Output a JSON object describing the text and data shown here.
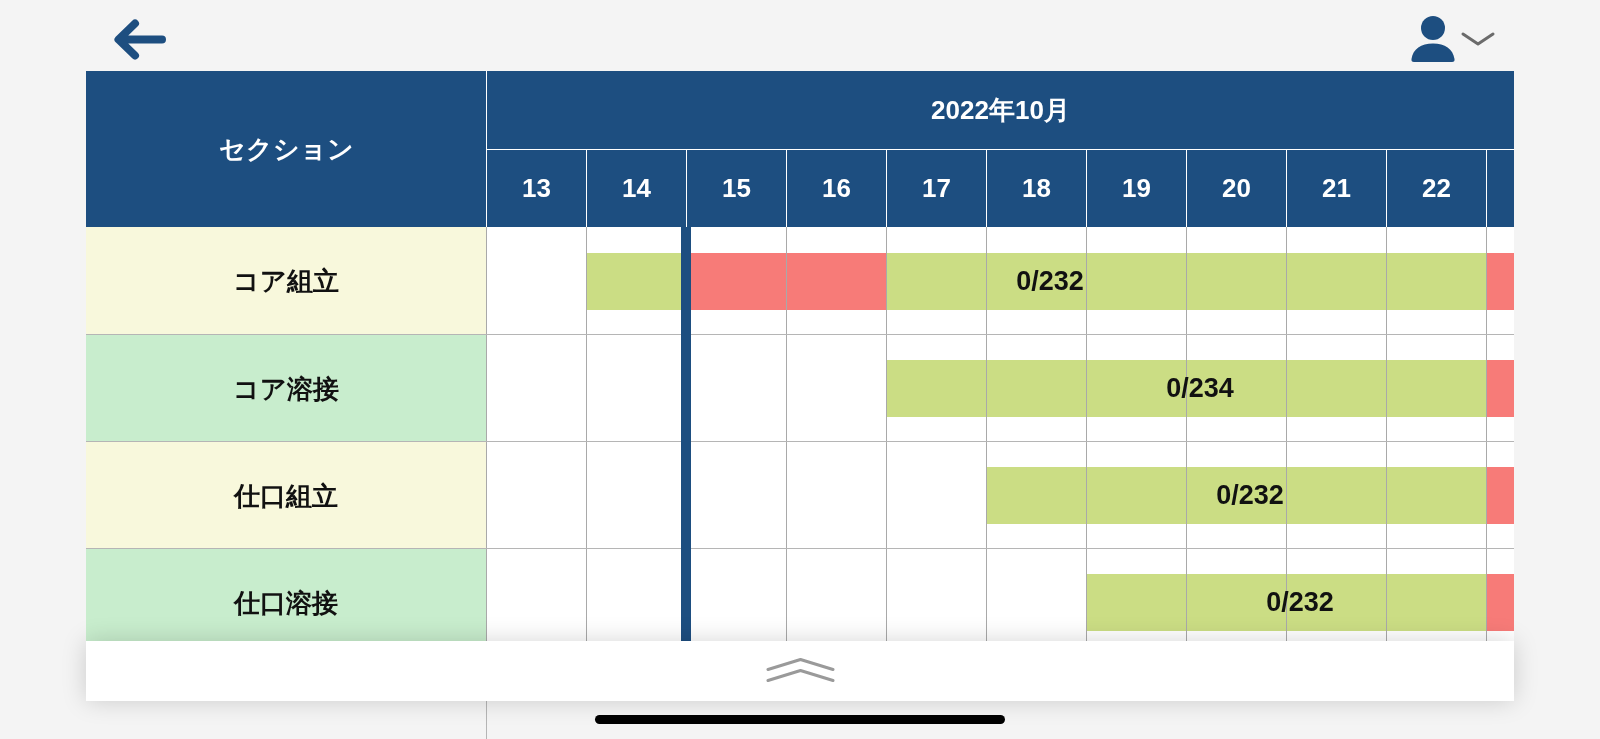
{
  "table": {
    "section_header": "セクション",
    "month": "2022年10月",
    "days": [
      {
        "label": "13",
        "today": false
      },
      {
        "label": "14",
        "today": false
      },
      {
        "label": "15",
        "today": true
      },
      {
        "label": "16",
        "today": false
      },
      {
        "label": "17",
        "today": false
      },
      {
        "label": "18",
        "today": false
      },
      {
        "label": "19",
        "today": false
      },
      {
        "label": "20",
        "today": false
      },
      {
        "label": "21",
        "today": false
      },
      {
        "label": "22",
        "today": false
      }
    ],
    "rows": [
      {
        "section": "コア組立",
        "kind": "assembly",
        "progress": "0/232",
        "cells": [
          {
            "kind": "empty"
          },
          {
            "kind": "planned"
          },
          {
            "kind": "delayed"
          },
          {
            "kind": "delayed"
          },
          {
            "kind": "planned"
          },
          {
            "kind": "planned"
          },
          {
            "kind": "planned"
          },
          {
            "kind": "planned"
          },
          {
            "kind": "planned"
          },
          {
            "kind": "planned"
          },
          {
            "kind": "delayed"
          }
        ]
      },
      {
        "section": "コア溶接",
        "kind": "welding",
        "progress": "0/234",
        "cells": [
          {
            "kind": "empty"
          },
          {
            "kind": "empty"
          },
          {
            "kind": "empty"
          },
          {
            "kind": "empty"
          },
          {
            "kind": "planned"
          },
          {
            "kind": "planned"
          },
          {
            "kind": "planned"
          },
          {
            "kind": "planned"
          },
          {
            "kind": "planned"
          },
          {
            "kind": "planned"
          },
          {
            "kind": "delayed"
          }
        ]
      },
      {
        "section": "仕口組立",
        "kind": "assembly",
        "progress": "0/232",
        "cells": [
          {
            "kind": "empty"
          },
          {
            "kind": "empty"
          },
          {
            "kind": "empty"
          },
          {
            "kind": "empty"
          },
          {
            "kind": "empty"
          },
          {
            "kind": "planned"
          },
          {
            "kind": "planned"
          },
          {
            "kind": "planned"
          },
          {
            "kind": "planned"
          },
          {
            "kind": "planned"
          },
          {
            "kind": "delayed"
          }
        ]
      },
      {
        "section": "仕口溶接",
        "kind": "welding",
        "progress": "0/232",
        "cells": [
          {
            "kind": "empty"
          },
          {
            "kind": "empty"
          },
          {
            "kind": "empty"
          },
          {
            "kind": "empty"
          },
          {
            "kind": "empty"
          },
          {
            "kind": "empty"
          },
          {
            "kind": "planned"
          },
          {
            "kind": "planned"
          },
          {
            "kind": "planned"
          },
          {
            "kind": "planned"
          },
          {
            "kind": "delayed"
          }
        ]
      }
    ]
  }
}
